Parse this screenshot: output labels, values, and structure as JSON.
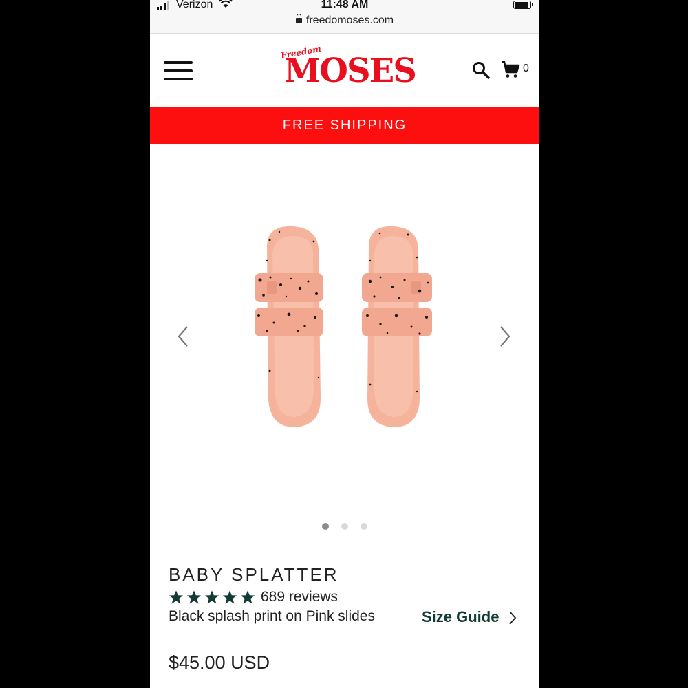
{
  "status_bar": {
    "carrier": "Verizon",
    "time": "11:48 AM"
  },
  "browser": {
    "url": "freedomoses.com"
  },
  "header": {
    "logo_small": "Freedom",
    "logo_big": "MOSES",
    "cart_count": "0"
  },
  "banner": {
    "text": "FREE SHIPPING"
  },
  "carousel": {
    "image_alt": "Baby Splatter slides",
    "active_index": 1,
    "count": 3
  },
  "product": {
    "name": "BABY SPLATTER",
    "rating": 5,
    "reviews": "689 reviews",
    "description": "Black splash print on Pink slides",
    "size_guide": "Size Guide",
    "price": "$45.00 USD"
  },
  "colors": {
    "brand_red": "#e8101e",
    "banner_red": "#fe0f0f",
    "star_green": "#133a34",
    "slide_pink": "#f6b39c"
  }
}
